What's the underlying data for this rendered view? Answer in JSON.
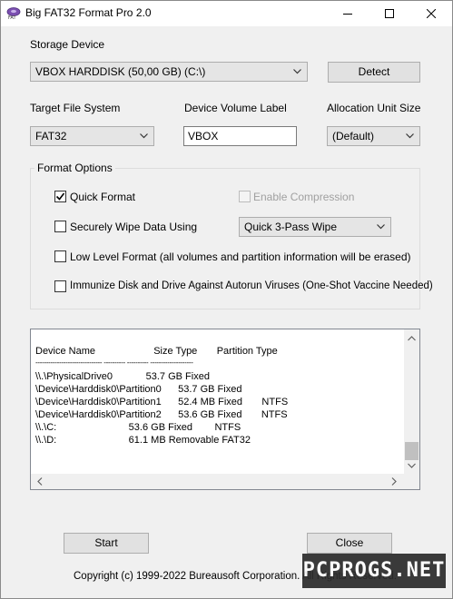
{
  "window": {
    "title": "Big FAT32 Format Pro 2.0"
  },
  "titlebar": {
    "minimize": "minimize-icon",
    "maximize": "maximize-icon",
    "close": "close-icon"
  },
  "storage": {
    "label": "Storage Device",
    "selected": "VBOX HARDDISK (50,00 GB) (C:\\)",
    "detect_label": "Detect"
  },
  "target": {
    "fs_label": "Target File System",
    "fs_value": "FAT32",
    "volume_label_caption": "Device Volume Label",
    "volume_label_value": "VBOX",
    "alloc_label": "Allocation Unit Size",
    "alloc_value": "(Default)"
  },
  "format_options": {
    "title": "Format Options",
    "quick_format": {
      "label": "Quick Format",
      "checked": true
    },
    "enable_compression": {
      "label": "Enable Compression",
      "checked": false,
      "disabled": true
    },
    "secure_wipe": {
      "label": "Securely Wipe Data Using",
      "checked": false
    },
    "wipe_method": "Quick 3-Pass Wipe",
    "low_level": {
      "label": "Low Level Format (all volumes and partition information will be erased)",
      "checked": false
    },
    "immunize": {
      "label": "Immunize Disk and Drive Against Autorun Viruses (One-Shot Vaccine Needed)",
      "checked": false
    }
  },
  "device_list": {
    "header": "Device Name                     Size Type       Partition Type",
    "separator": "------------------------------- ---------- ---------- --------------------",
    "rows": [
      "\\\\.\\PhysicalDrive0            53.7 GB Fixed",
      "\\Device\\Harddisk0\\Partition0      53.7 GB Fixed",
      "\\Device\\Harddisk0\\Partition1      52.4 MB Fixed       NTFS",
      "\\Device\\Harddisk0\\Partition2      53.6 GB Fixed       NTFS",
      "\\\\.\\C:                          53.6 GB Fixed        NTFS",
      "\\\\.\\D:                          61.1 MB Removable FAT32"
    ]
  },
  "actions": {
    "start_label": "Start",
    "close_label": "Close"
  },
  "footer": {
    "copyright": "Copyright (c) 1999-2022 Bureausoft Corporation. All Rights Reserved."
  },
  "watermark": {
    "text": "PCPROGS.NET"
  },
  "colors": {
    "window_bg": "#f0f0f0",
    "titlebar_bg": "#ffffff",
    "button_bg": "#e1e1e1",
    "border": "#adadad"
  }
}
